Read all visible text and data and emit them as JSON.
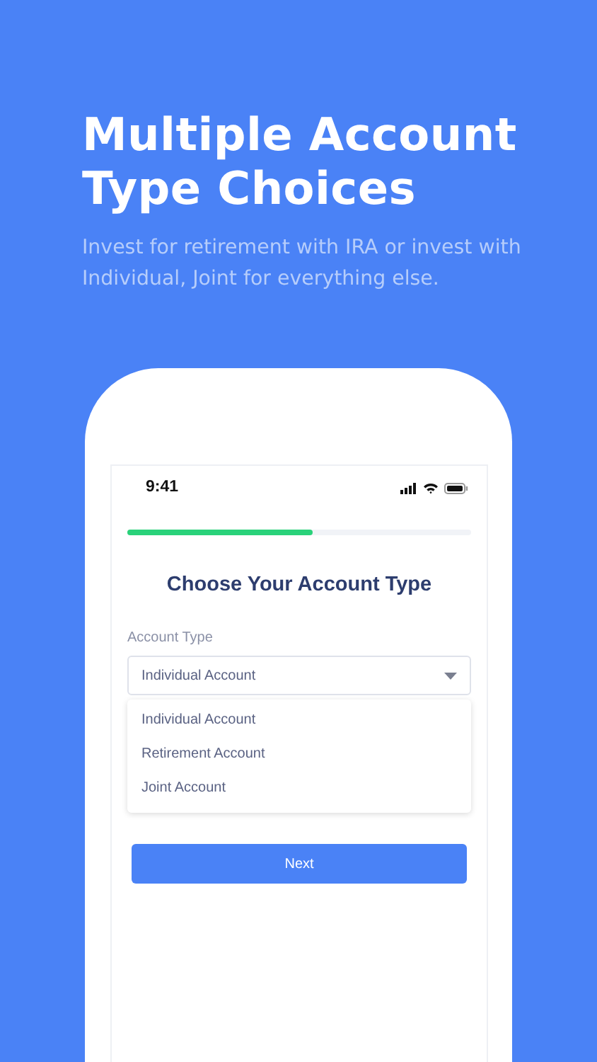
{
  "headline": "Multiple Account Type Choices",
  "subtitle": "Invest for retirement with IRA or invest with Individual, Joint for everything else.",
  "phone": {
    "status_bar": {
      "time": "9:41"
    },
    "progress": {
      "level": 0.54
    },
    "title": "Choose Your Account Type",
    "field": {
      "label": "Account Type",
      "value": "Individual Account"
    },
    "dropdown": {
      "options": [
        {
          "label": "Individual Account"
        },
        {
          "label": "Retirement Account"
        },
        {
          "label": "Joint Account"
        }
      ]
    },
    "next_button": "Next"
  }
}
